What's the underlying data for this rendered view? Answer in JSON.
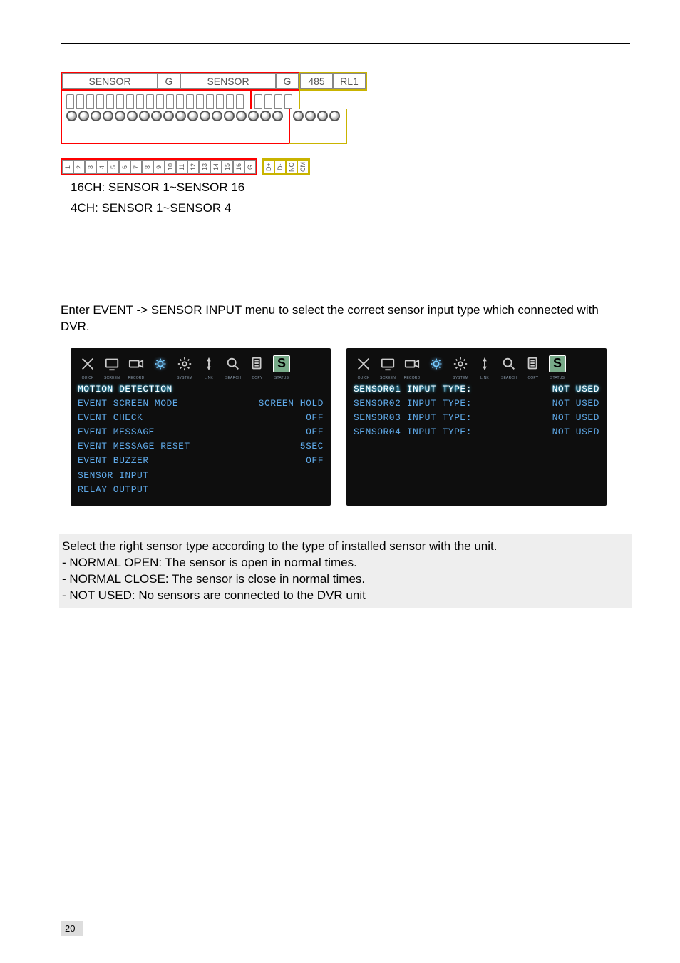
{
  "diagram": {
    "sensor_label": "SENSOR",
    "g_label": "G",
    "right_labels": [
      "485",
      "RL1"
    ],
    "numbers_left": [
      "1",
      "2",
      "3",
      "4",
      "5",
      "6",
      "7",
      "8",
      "9",
      "10",
      "11",
      "12",
      "13",
      "14",
      "15",
      "16",
      "G"
    ],
    "numbers_right": [
      "D+",
      "D-",
      "NO",
      "CM"
    ]
  },
  "captions": {
    "line1": "16CH: SENSOR 1~SENSOR 16",
    "line2": "4CH: SENSOR 1~SENSOR 4"
  },
  "para": "Enter EVENT -> SENSOR INPUT menu to select the correct sensor input type which connected with DVR.",
  "iconbar": {
    "labels": [
      "QUICK",
      "SCREEN",
      "RECORD",
      "",
      "SYSTEM",
      "LINK",
      "SEARCH",
      "COPY",
      "STATUS"
    ]
  },
  "shot1": {
    "rows": [
      {
        "l": "MOTION DETECTION",
        "r": "",
        "hl": true
      },
      {
        "l": "EVENT SCREEN MODE",
        "r": "SCREEN HOLD"
      },
      {
        "l": "EVENT CHECK",
        "r": "OFF"
      },
      {
        "l": "EVENT MESSAGE",
        "r": "OFF"
      },
      {
        "l": "EVENT MESSAGE RESET",
        "r": "5SEC"
      },
      {
        "l": "EVENT BUZZER",
        "r": "OFF"
      },
      {
        "l": "SENSOR INPUT",
        "r": ""
      },
      {
        "l": "RELAY OUTPUT",
        "r": ""
      }
    ]
  },
  "shot2": {
    "rows": [
      {
        "l": "SENSOR01 INPUT TYPE:",
        "r": "NOT USED",
        "hl": true
      },
      {
        "l": "SENSOR02 INPUT TYPE:",
        "r": "NOT USED"
      },
      {
        "l": "SENSOR03 INPUT TYPE:",
        "r": "NOT USED"
      },
      {
        "l": "SENSOR04 INPUT TYPE:",
        "r": "NOT USED"
      }
    ]
  },
  "note": {
    "l1": "Select the right sensor type according to the type of installed sensor with the unit.",
    "l2": "- NORMAL OPEN: The sensor is open in normal times.",
    "l3": "- NORMAL CLOSE: The sensor is close in normal times.",
    "l4": "- NOT USED: No sensors are connected to the DVR unit"
  },
  "page_number": "20"
}
